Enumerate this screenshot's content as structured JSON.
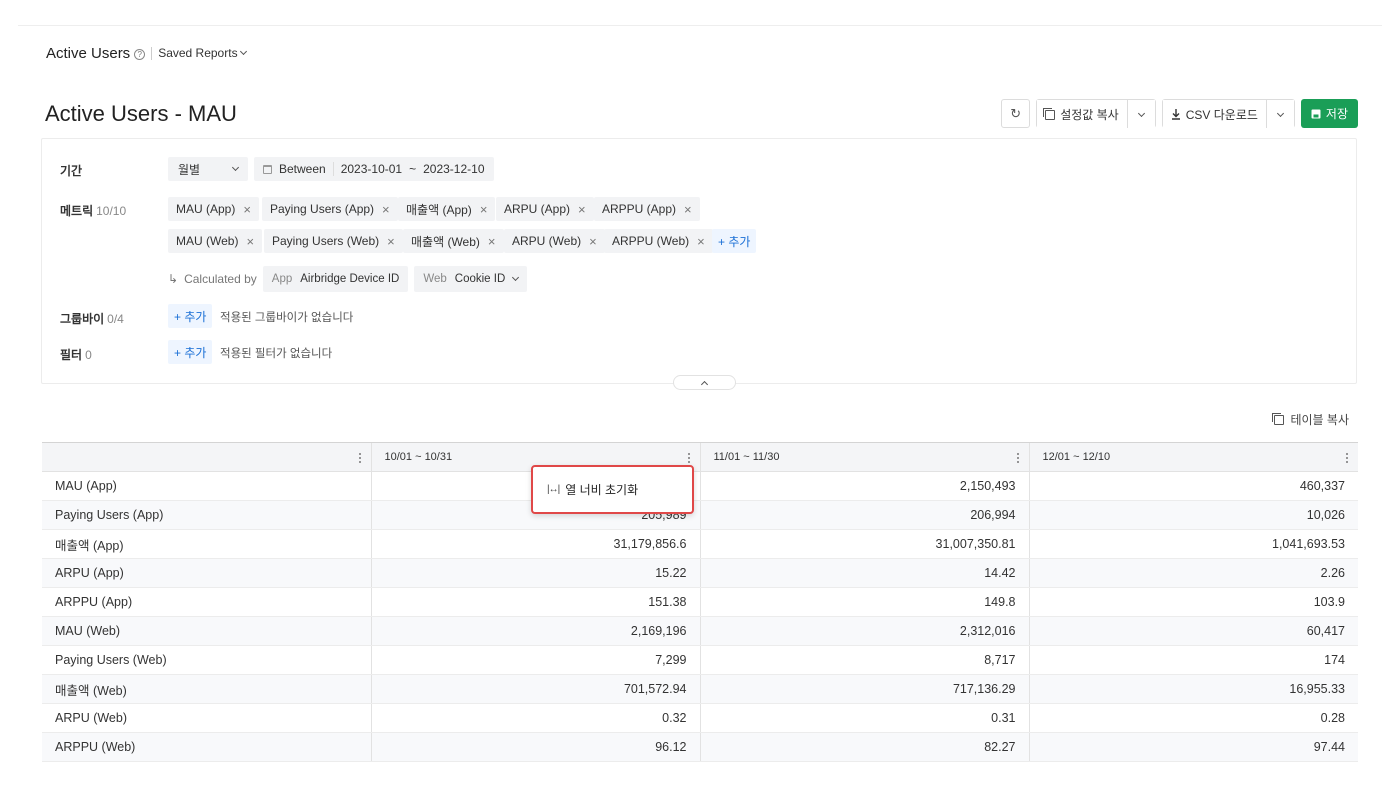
{
  "breadcrumb": {
    "title": "Active Users",
    "help_icon": "?",
    "saved_reports": "Saved Reports"
  },
  "page": {
    "title": "Active Users - MAU"
  },
  "toolbar": {
    "refresh_icon": "↻",
    "copy_settings": "설정값 복사",
    "csv_download": "CSV 다운로드",
    "save": "저장",
    "save_color": "#1a9e57"
  },
  "filters": {
    "period": {
      "label": "기간",
      "select": "월별",
      "between": "Between",
      "start": "2023-10-01",
      "tilde": "~",
      "end": "2023-12-10"
    },
    "metrics": {
      "label": "메트릭",
      "count": "10/10",
      "row1": [
        "MAU (App)",
        "Paying Users (App)",
        "매출액 (App)",
        "ARPU (App)",
        "ARPPU (App)"
      ],
      "row2": [
        "MAU (Web)",
        "Paying Users (Web)",
        "매출액 (Web)",
        "ARPU (Web)",
        "ARPPU (Web)"
      ],
      "add": "+ 추가",
      "remove": "×"
    },
    "calculated_by": {
      "arrow": "↳",
      "label": "Calculated by",
      "app_key": "App",
      "app_value": "Airbridge Device ID",
      "web_key": "Web",
      "web_value": "Cookie ID"
    },
    "groupby": {
      "label": "그룹바이",
      "count": "0/4",
      "add": "+ 추가",
      "empty": "적용된 그룹바이가 없습니다"
    },
    "filter": {
      "label": "필터",
      "count": "0",
      "add": "+ 추가",
      "empty": "적용된 필터가 없습니다"
    }
  },
  "table_copy": "테이블 복사",
  "table": {
    "columns": [
      "",
      "10/01 ~ 10/31",
      "11/01 ~ 11/30",
      "12/01 ~ 12/10"
    ],
    "rows": [
      [
        "MAU (App)",
        "",
        "2,150,493",
        "460,337"
      ],
      [
        "Paying Users (App)",
        "205,989",
        "206,994",
        "10,026"
      ],
      [
        "매출액 (App)",
        "31,179,856.6",
        "31,007,350.81",
        "1,041,693.53"
      ],
      [
        "ARPU (App)",
        "15.22",
        "14.42",
        "2.26"
      ],
      [
        "ARPPU (App)",
        "151.38",
        "149.8",
        "103.9"
      ],
      [
        "MAU (Web)",
        "2,169,196",
        "2,312,016",
        "60,417"
      ],
      [
        "Paying Users (Web)",
        "7,299",
        "8,717",
        "174"
      ],
      [
        "매출액 (Web)",
        "701,572.94",
        "717,136.29",
        "16,955.33"
      ],
      [
        "ARPU (Web)",
        "0.32",
        "0.31",
        "0.28"
      ],
      [
        "ARPPU (Web)",
        "96.12",
        "82.27",
        "97.44"
      ]
    ]
  },
  "context_menu": {
    "icon": "|↔|",
    "label": "열 너비 초기화"
  }
}
